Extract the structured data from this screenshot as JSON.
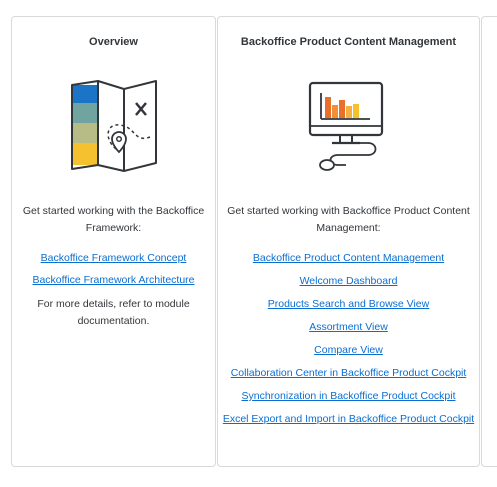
{
  "overview": {
    "title": "Overview",
    "intro": "Get started working with the Backoffice Framework:",
    "links": [
      "Backoffice Framework Concept",
      "Backoffice Framework Architecture"
    ],
    "more": "For more details, refer to module documentation.",
    "icon": "map-icon"
  },
  "bpc": {
    "title": "Backoffice Product Content Management",
    "intro": "Get started working with Backoffice Product Content Management:",
    "links": [
      "Backoffice Product Content Management",
      "Welcome Dashboard",
      "Products Search and Browse View",
      "Assortment View",
      "Compare View",
      "Collaboration Center in Backoffice Product Cockpit",
      "Synchronization in Backoffice Product Cockpit",
      "Excel Export and Import in Backoffice Product Cockpit"
    ],
    "icon": "monitor-chart-icon"
  },
  "colors": {
    "link": "#0a6ed1",
    "border": "#d9d9d9",
    "text": "#32363a"
  }
}
